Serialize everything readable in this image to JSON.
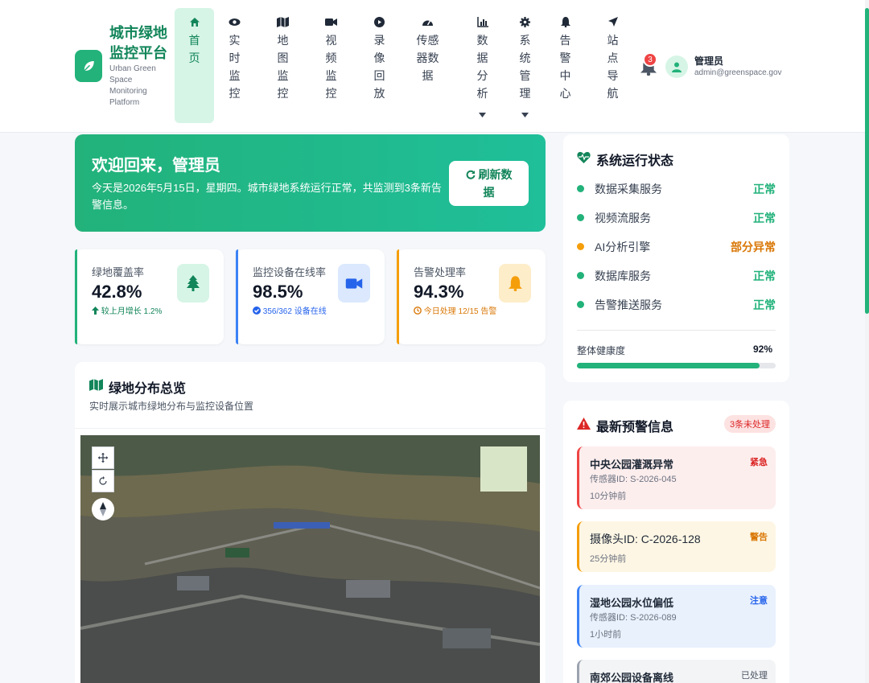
{
  "brand": {
    "title": "城市绿地监控平台",
    "subtitle": "Urban Green Space Monitoring Platform"
  },
  "nav": [
    {
      "label": "首页",
      "icon": "home-icon",
      "active": true
    },
    {
      "label": "实时监控",
      "icon": "eye-icon"
    },
    {
      "label": "地图监控",
      "icon": "map-icon"
    },
    {
      "label": "视频监控",
      "icon": "video-icon"
    },
    {
      "label": "录像回放",
      "icon": "play-icon"
    },
    {
      "label": "传感器数据",
      "icon": "gauge-icon"
    },
    {
      "label": "数据分析",
      "icon": "bar-chart-icon",
      "dropdown": true
    },
    {
      "label": "系统管理",
      "icon": "gear-icon",
      "dropdown": true
    },
    {
      "label": "告警中心",
      "icon": "bell-icon"
    },
    {
      "label": "站点导航",
      "icon": "location-arrow-icon"
    }
  ],
  "header": {
    "notification_count": "3",
    "user_name": "管理员",
    "user_email": "admin@greenspace.gov"
  },
  "welcome": {
    "title": "欢迎回来，管理员",
    "text": "今天是2026年5月15日，星期四。城市绿地系统运行正常，共监测到3条新告警信息。",
    "refresh_label": "刷新数据"
  },
  "stats": [
    {
      "label": "绿地覆盖率",
      "value": "42.8%",
      "foot": "较上月增长 1.2%",
      "icon": "tree-icon",
      "color": "#22b27a"
    },
    {
      "label": "监控设备在线率",
      "value": "98.5%",
      "foot": "356/362 设备在线",
      "icon": "video-icon",
      "color": "#3b82f6"
    },
    {
      "label": "告警处理率",
      "value": "94.3%",
      "foot": "今日处理 12/15 告警",
      "icon": "bell-icon",
      "color": "#f59e0b"
    }
  ],
  "map": {
    "title": "绿地分布总览",
    "subtitle": "实时展示城市绿地分布与监控设备位置"
  },
  "system_status": {
    "title": "系统运行状态",
    "services": [
      {
        "name": "数据采集服务",
        "state": "正常",
        "color": "#22b27a"
      },
      {
        "name": "视频流服务",
        "state": "正常",
        "color": "#22b27a"
      },
      {
        "name": "AI分析引擎",
        "state": "部分异常",
        "color": "#f59e0b"
      },
      {
        "name": "数据库服务",
        "state": "正常",
        "color": "#22b27a"
      },
      {
        "name": "告警推送服务",
        "state": "正常",
        "color": "#22b27a"
      }
    ],
    "health_label": "整体健康度",
    "health_value": "92%",
    "health_fraction": 0.92
  },
  "alerts": {
    "title": "最新预警信息",
    "badge": "3条未处理",
    "items": [
      {
        "title": "中央公园灌溉异常",
        "level": "紧急",
        "meta": "传感器ID: S-2026-045",
        "time": "10分钟前",
        "color": "#ef4444",
        "bg": "#fdeeee"
      },
      {
        "title": "摄像头ID: C-2026-128",
        "level": "警告",
        "meta": "",
        "time": "25分钟前",
        "color": "#f59e0b",
        "bg": "#fef6e4"
      },
      {
        "title": "湿地公园水位偏低",
        "level": "注意",
        "meta": "传感器ID: S-2026-089",
        "time": "1小时前",
        "color": "#3b82f6",
        "bg": "#e9f1fd"
      },
      {
        "title": "南郊公园设备离线",
        "level": "已处理",
        "meta": "",
        "time": "",
        "color": "#9ca3af",
        "bg": "#f3f4f6"
      }
    ]
  }
}
